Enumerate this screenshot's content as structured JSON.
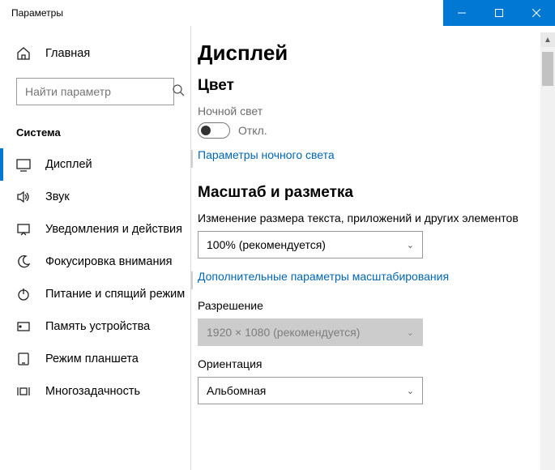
{
  "titlebar": {
    "title": "Параметры"
  },
  "sidebar": {
    "home": "Главная",
    "search_placeholder": "Найти параметр",
    "heading": "Система",
    "items": [
      "Дисплей",
      "Звук",
      "Уведомления и действия",
      "Фокусировка внимания",
      "Питание и спящий режим",
      "Память устройства",
      "Режим планшета",
      "Многозадачность"
    ]
  },
  "page": {
    "title": "Дисплей",
    "color_heading": "Цвет",
    "night_light_label": "Ночной свет",
    "night_light_state": "Откл.",
    "night_light_link": "Параметры ночного света",
    "scale_heading": "Масштаб и разметка",
    "scale_label": "Изменение размера текста, приложений и других элементов",
    "scale_value": "100% (рекомендуется)",
    "scale_link": "Дополнительные параметры масштабирования",
    "resolution_label": "Разрешение",
    "resolution_value": "1920 × 1080 (рекомендуется)",
    "orientation_label": "Ориентация",
    "orientation_value": "Альбомная"
  }
}
